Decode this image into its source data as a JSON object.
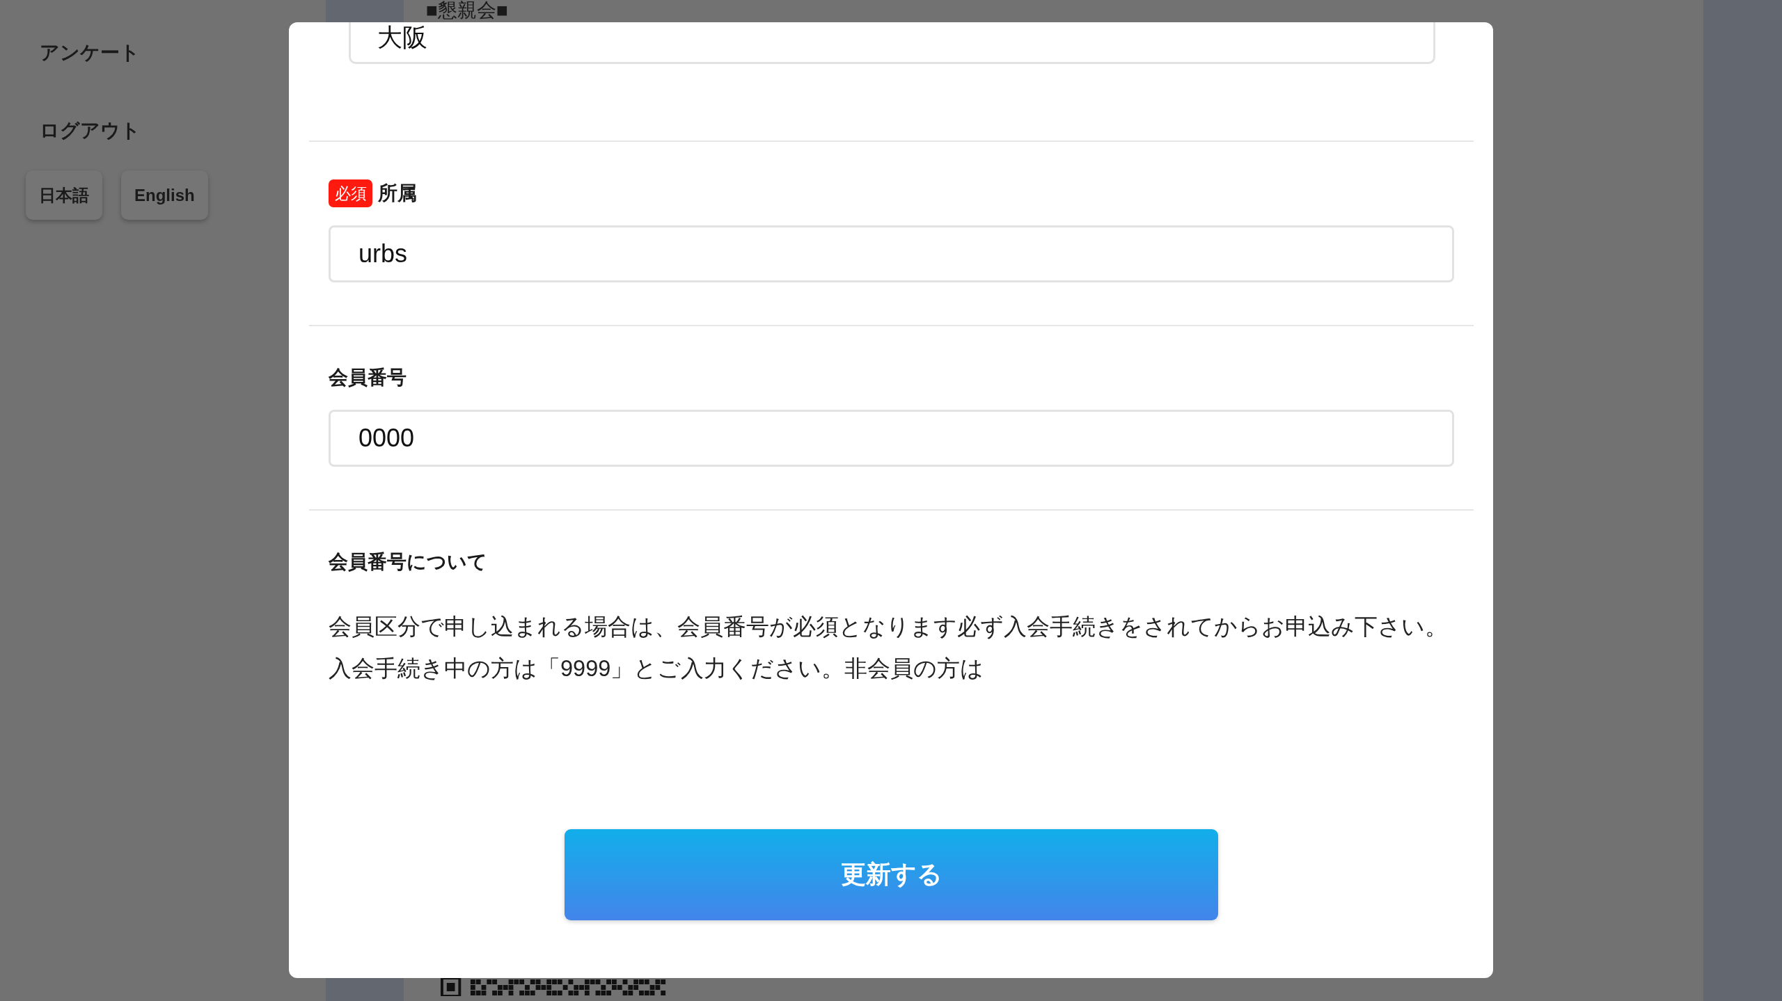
{
  "background": {
    "sidebar": {
      "items": [
        {
          "label": "アンケート"
        },
        {
          "label": "ログアウト"
        }
      ],
      "language_buttons": [
        {
          "label": "日本語"
        },
        {
          "label": "English"
        }
      ]
    },
    "heading": "■懇親会■"
  },
  "modal": {
    "scrolled_field": {
      "value": "大阪"
    },
    "fields": [
      {
        "badge": "必須",
        "label": "所属",
        "value": "urbs"
      },
      {
        "label": "会員番号",
        "value": "0000"
      }
    ],
    "note": {
      "title": "会員番号について",
      "text": "会員区分で申し込まれる場合は、会員番号が必須となります必ず入会手続きをされてからお申込み下さい。入会手続き中の方は「9999」とご入力ください。非会員の方は"
    },
    "submit_button": "更新する"
  }
}
